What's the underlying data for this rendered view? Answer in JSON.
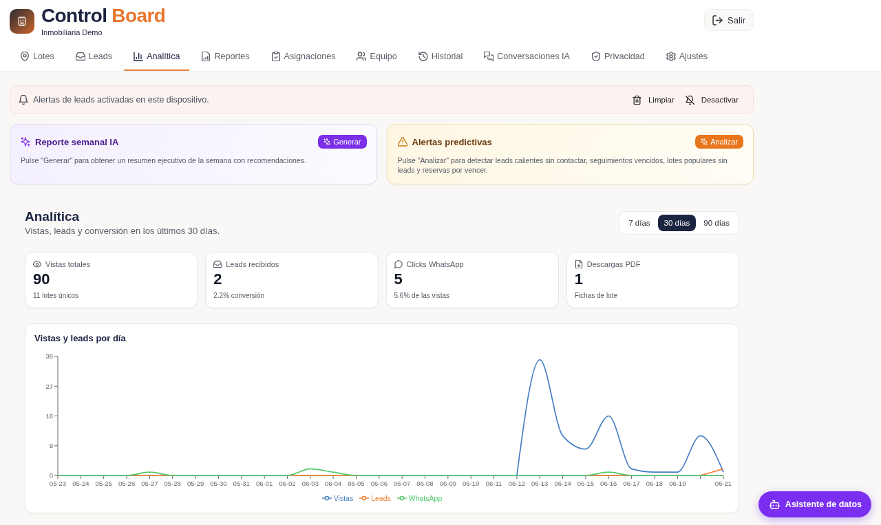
{
  "header": {
    "title": "Control",
    "title_accent": "Board",
    "subtitle": "Inmobiliaria Demo",
    "logout_button": "Salir"
  },
  "tabs": [
    {
      "label": "Lotes",
      "selected": false
    },
    {
      "label": "Leads",
      "selected": false
    },
    {
      "label": "Analítica",
      "selected": true
    },
    {
      "label": "Reportes",
      "selected": false
    },
    {
      "label": "Asignaciones",
      "selected": false
    },
    {
      "label": "Equipo",
      "selected": false
    },
    {
      "label": "Historial",
      "selected": false
    },
    {
      "label": "Conversaciones IA",
      "selected": false
    },
    {
      "label": "Privacidad",
      "selected": false
    },
    {
      "label": "Ajustes",
      "selected": false
    }
  ],
  "alert_bar": {
    "message": "Alertas de leads activadas en este dispositivo.",
    "actions": [
      "Limpiar",
      "Desactivar"
    ]
  },
  "ai_cards": [
    {
      "kind": "report",
      "title": "Reporte semanal IA",
      "button": "Generar",
      "description": "Pulse \"Generar\" para obtener un resumen ejecutivo de la semana con recomendaciones."
    },
    {
      "kind": "predictive",
      "title": "Alertas predictivas",
      "button": "Analizar",
      "description": "Pulse \"Analizar\" para detectar leads calientes sin contactar, seguimientos vencidos, lotes populares sin leads y reservas por vencer."
    }
  ],
  "analytics": {
    "title": "Analítica",
    "subtitle": "Vistas, leads y conversión en los últimos 30 días.",
    "ranges": [
      {
        "label": "7 días",
        "selected": false
      },
      {
        "label": "30 días",
        "selected": true
      },
      {
        "label": "90 días",
        "selected": false
      }
    ],
    "kpis": [
      {
        "label": "Vistas totales",
        "value": "90",
        "note": "11 lotes únicos"
      },
      {
        "label": "Leads recibidos",
        "value": "2",
        "note": "2.2% conversión"
      },
      {
        "label": "Clicks WhatsApp",
        "value": "5",
        "note": "5.6% de las vistas"
      },
      {
        "label": "Descargas PDF",
        "value": "1",
        "note": "Fichas de lote"
      }
    ],
    "chart": {
      "chart_data": {
        "type": "line",
        "title": "Vistas y leads por día",
        "categories": [
          "05-23",
          "05-24",
          "05-25",
          "05-26",
          "05-27",
          "05-28",
          "05-29",
          "05-30",
          "05-31",
          "06-01",
          "06-02",
          "06-03",
          "06-04",
          "06-05",
          "06-06",
          "06-07",
          "06-08",
          "06-09",
          "06-10",
          "06-11",
          "06-12",
          "06-13",
          "06-14",
          "06-15",
          "06-16",
          "06-17",
          "06-18",
          "06-19",
          null,
          "06-21"
        ],
        "series": [
          {
            "name": "Vistas",
            "color": "#4a7fc4",
            "values": [
              null,
              null,
              null,
              null,
              null,
              null,
              null,
              null,
              null,
              null,
              null,
              null,
              null,
              null,
              null,
              null,
              null,
              null,
              null,
              null,
              0,
              35,
              12,
              8,
              18,
              2,
              1,
              1,
              12,
              1
            ]
          },
          {
            "name": "Leads",
            "color": "#ee7d2e",
            "values": [
              null,
              null,
              null,
              0,
              0,
              0,
              null,
              null,
              null,
              null,
              0,
              0,
              0,
              0,
              null,
              null,
              null,
              null,
              null,
              null,
              null,
              null,
              null,
              0,
              0,
              0,
              null,
              null,
              0,
              2
            ]
          },
          {
            "name": "WhatsApp",
            "color": "#4fc96b",
            "values": [
              0,
              0,
              0,
              0,
              1,
              0,
              0,
              0,
              0,
              0,
              0,
              2,
              1,
              0,
              0,
              0,
              0,
              0,
              0,
              0,
              0,
              0,
              0,
              0,
              1,
              0,
              0,
              0,
              0,
              0
            ]
          }
        ],
        "ylim": [
          0,
          36
        ],
        "yticks": [
          0,
          9,
          18,
          27,
          36
        ],
        "legend": "bottom"
      }
    }
  },
  "assistant_button": "Asistente de datos"
}
